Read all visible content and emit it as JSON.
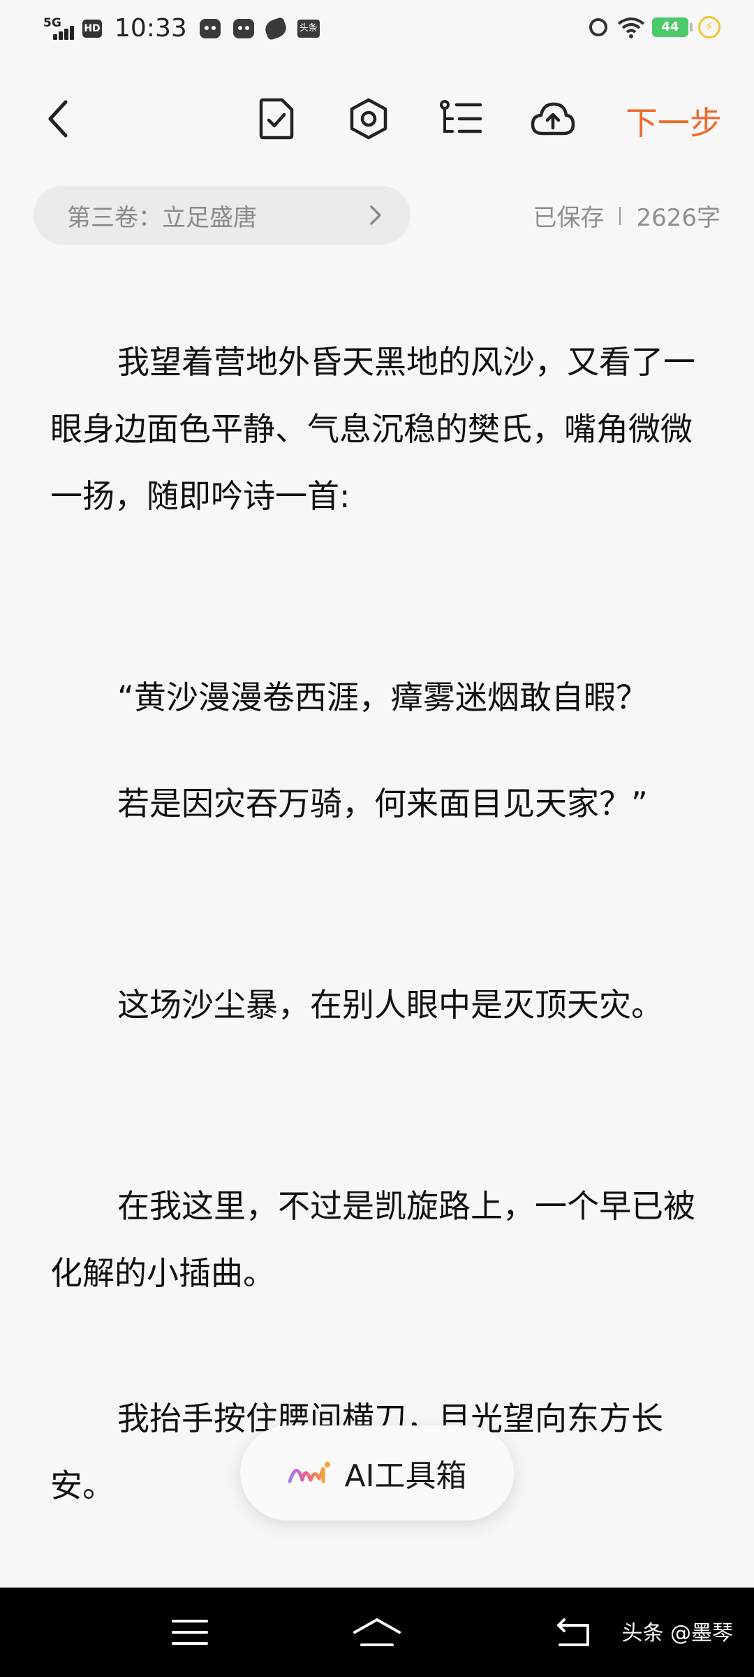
{
  "status_bar": {
    "network": "5G",
    "hd_badge": "HD",
    "time": "10:33",
    "notification_badge": "头条",
    "battery_level": "44"
  },
  "toolbar": {
    "back_icon": "chevron-left-icon",
    "icons": [
      "document-check-icon",
      "settings-hexagon-icon",
      "outline-list-icon",
      "cloud-upload-icon"
    ],
    "next_label": "下一步",
    "accent_color": "#f06a2b"
  },
  "chapter": {
    "title": "第三卷：立足盛唐",
    "save_status": "已保存",
    "word_count": "2626字"
  },
  "content": {
    "paragraphs": [
      "我望着营地外昏天黑地的风沙，又看了一眼身边面色平静、气息沉稳的樊氏，嘴角微微一扬，随即吟诗一首:",
      "“黄沙漫漫卷西涯，瘴雾迷烟敢自暇？",
      "若是因灾吞万骑，何来面目见天家？”",
      "这场沙尘暴，在别人眼中是灭顶天灾。",
      "在我这里，不过是凯旋路上，一个早已被化解的小插曲。",
      "我抬手按住腰间横刀，目光望向东方长安。"
    ]
  },
  "ai_toolbox": {
    "label": "AI工具箱"
  },
  "nav_bar": {
    "watermark": "头条 @墨琴"
  }
}
